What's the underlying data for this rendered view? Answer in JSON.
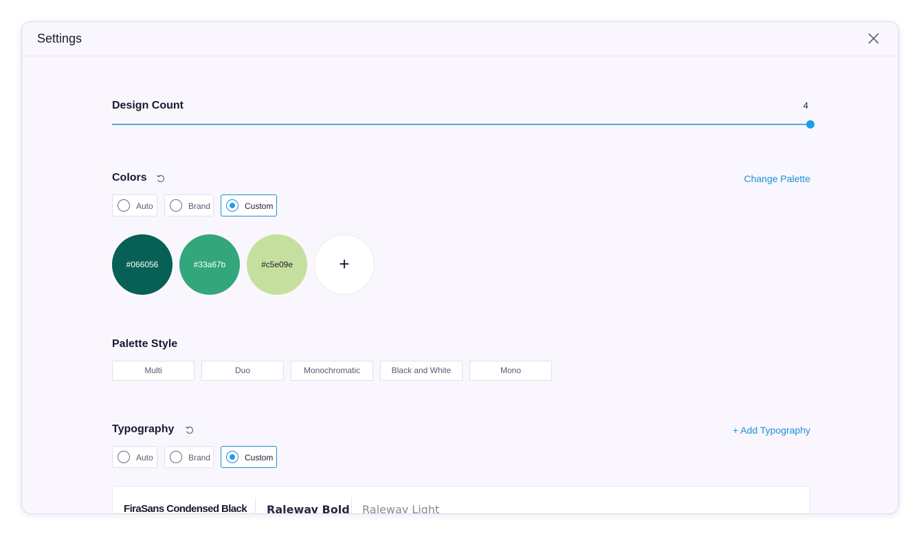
{
  "modal": {
    "title": "Settings",
    "close_icon": "close-icon"
  },
  "design_count": {
    "label": "Design Count",
    "value": "4",
    "level": 1.0
  },
  "colors": {
    "title": "Colors",
    "reset_icon": "reset-icon",
    "change_palette": "Change Palette",
    "options": [
      {
        "label": "Auto",
        "selected": false
      },
      {
        "label": "Brand",
        "selected": false
      },
      {
        "label": "Custom",
        "selected": true
      }
    ],
    "swatches": [
      {
        "hex": "#066056",
        "text_color": "#ffffff"
      },
      {
        "hex": "#33a67b",
        "text_color": "#ffffff"
      },
      {
        "hex": "#c5e09e",
        "text_color": "#1d1733"
      }
    ],
    "add_label": "+"
  },
  "palette_style": {
    "title": "Palette Style",
    "options": [
      "Multi",
      "Duo",
      "Monochromatic",
      "Black and White",
      "Mono"
    ]
  },
  "typography": {
    "title": "Typography",
    "reset_icon": "reset-icon",
    "add_link": "+ Add Typography",
    "options": [
      {
        "label": "Auto",
        "selected": false
      },
      {
        "label": "Brand",
        "selected": false
      },
      {
        "label": "Custom",
        "selected": true
      }
    ],
    "fonts": [
      "FiraSans Condensed Black",
      "Raleway Bold",
      "Raleway Light"
    ]
  },
  "accent_color": "#1e9de9"
}
